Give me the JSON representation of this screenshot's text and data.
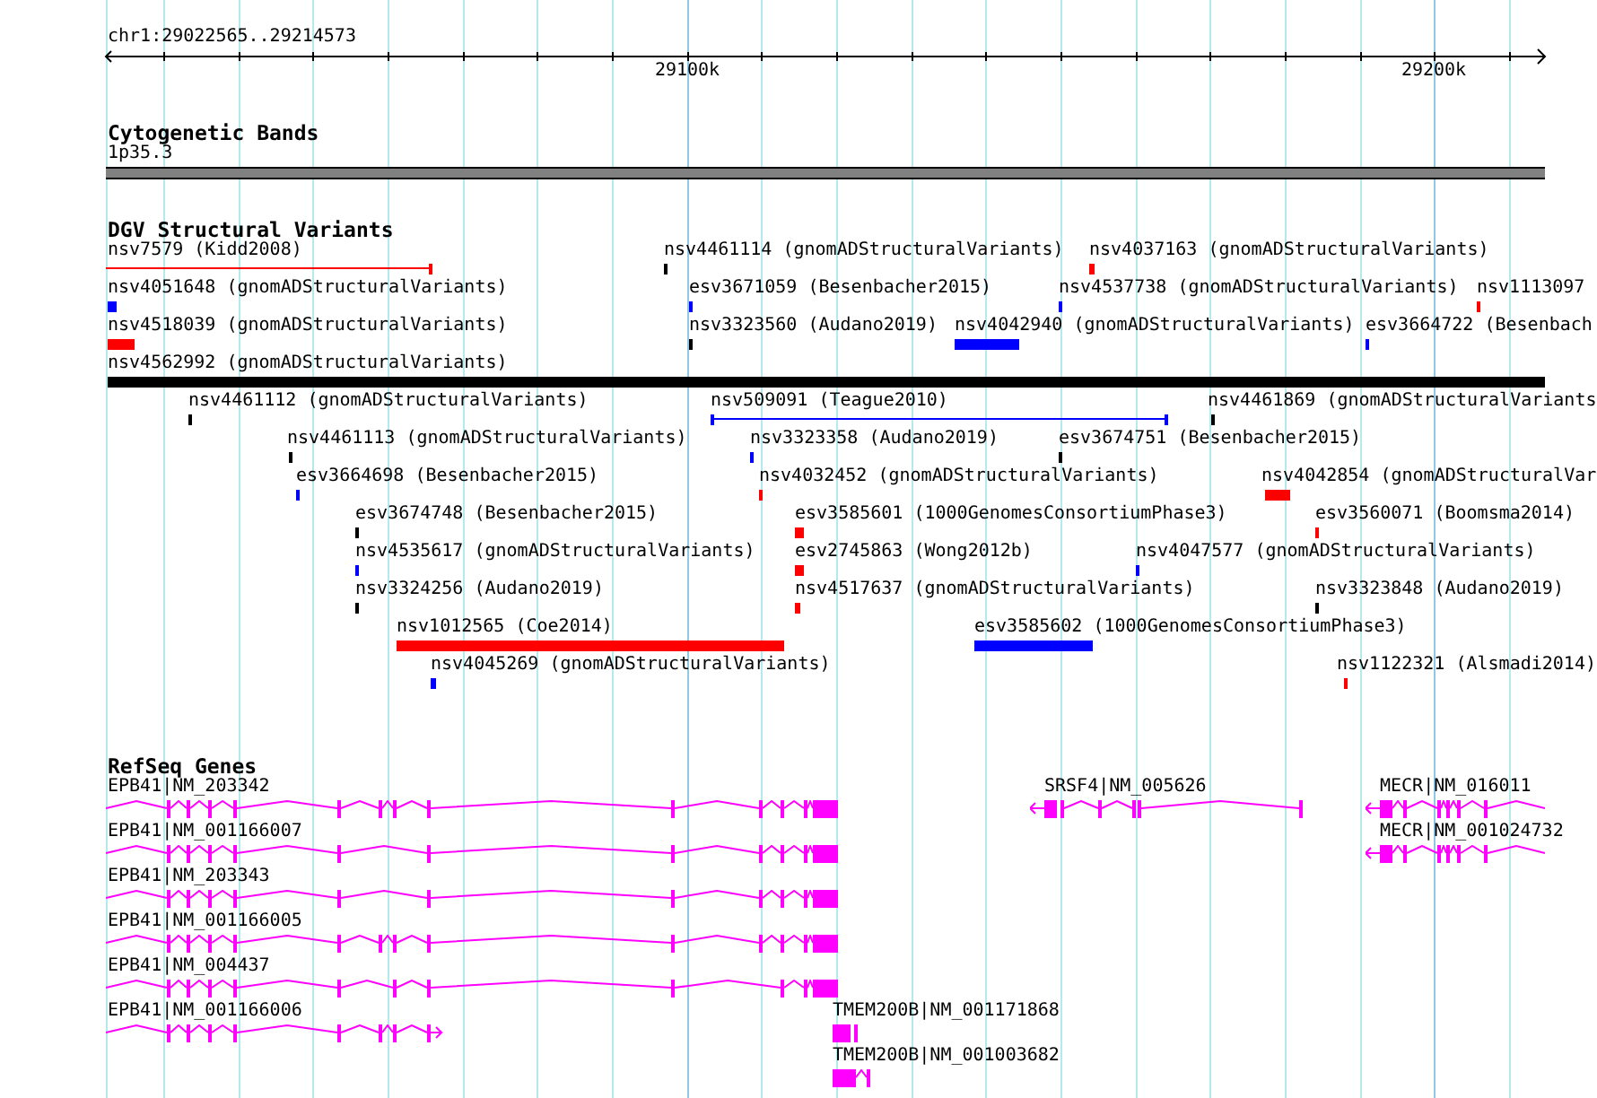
{
  "ruler": {
    "location": "chr1:29022565..29214573",
    "ticks": [
      {
        "label": "29100k"
      },
      {
        "label": "29200k"
      }
    ]
  },
  "tracks": [
    {
      "kind": "bands",
      "title": "Cytogenetic Bands",
      "band": {
        "label": "1p35.3"
      }
    },
    {
      "kind": "variants",
      "title": "DGV Structural Variants",
      "features": [
        {
          "label": "nsv7579 (Kidd2008)",
          "kind": "span",
          "color": "#ff0000"
        },
        {
          "label": "nsv4461114 (gnomADStructuralVariants)",
          "kind": "block",
          "color": "#000000"
        },
        {
          "label": "nsv4037163 (gnomADStructuralVariants)",
          "kind": "block",
          "color": "#ff0000"
        },
        {
          "label": "nsv4051648 (gnomADStructuralVariants)",
          "kind": "block",
          "color": "#0000ff"
        },
        {
          "label": "esv3671059 (Besenbacher2015)",
          "kind": "block",
          "color": "#0000ff"
        },
        {
          "label": "nsv4537738 (gnomADStructuralVariants)",
          "kind": "block",
          "color": "#0000ff"
        },
        {
          "label": "nsv1113097",
          "kind": "block",
          "color": "#ff0000"
        },
        {
          "label": "nsv4518039 (gnomADStructuralVariants)",
          "kind": "block",
          "color": "#ff0000"
        },
        {
          "label": "nsv3323560 (Audano2019)",
          "kind": "block",
          "color": "#000000"
        },
        {
          "label": "nsv4042940 (gnomADStructuralVariants)",
          "kind": "block",
          "color": "#0000ff"
        },
        {
          "label": "esv3664722 (Besenbach",
          "kind": "block",
          "color": "#0000ff"
        },
        {
          "label": "nsv4562992 (gnomADStructuralVariants)",
          "kind": "block",
          "color": "#000000"
        },
        {
          "label": "nsv4461112 (gnomADStructuralVariants)",
          "kind": "block",
          "color": "#000000"
        },
        {
          "label": "nsv509091 (Teague2010)",
          "kind": "span",
          "color": "#0000ff"
        },
        {
          "label": "nsv4461869 (gnomADStructuralVariants",
          "kind": "block",
          "color": "#000000"
        },
        {
          "label": "nsv4461113 (gnomADStructuralVariants)",
          "kind": "block",
          "color": "#000000"
        },
        {
          "label": "nsv3323358 (Audano2019)",
          "kind": "block",
          "color": "#0000ff"
        },
        {
          "label": "esv3674751 (Besenbacher2015)",
          "kind": "block",
          "color": "#000000"
        },
        {
          "label": "esv3664698 (Besenbacher2015)",
          "kind": "block",
          "color": "#0000ff"
        },
        {
          "label": "nsv4032452 (gnomADStructuralVariants)",
          "kind": "block",
          "color": "#ff0000"
        },
        {
          "label": "nsv4042854 (gnomADStructuralVar",
          "kind": "block",
          "color": "#ff0000"
        },
        {
          "label": "esv3674748 (Besenbacher2015)",
          "kind": "block",
          "color": "#000000"
        },
        {
          "label": "esv3585601 (1000GenomesConsortiumPhase3)",
          "kind": "block",
          "color": "#ff0000"
        },
        {
          "label": "esv3560071 (Boomsma2014)",
          "kind": "block",
          "color": "#ff0000"
        },
        {
          "label": "nsv4535617 (gnomADStructuralVariants)",
          "kind": "block",
          "color": "#0000ff"
        },
        {
          "label": "esv2745863 (Wong2012b)",
          "kind": "block",
          "color": "#ff0000"
        },
        {
          "label": "nsv4047577 (gnomADStructuralVariants)",
          "kind": "block",
          "color": "#0000ff"
        },
        {
          "label": "nsv3324256 (Audano2019)",
          "kind": "block",
          "color": "#000000"
        },
        {
          "label": "nsv4517637 (gnomADStructuralVariants)",
          "kind": "block",
          "color": "#ff0000"
        },
        {
          "label": "nsv3323848 (Audano2019)",
          "kind": "block",
          "color": "#000000"
        },
        {
          "label": "nsv1012565 (Coe2014)",
          "kind": "block",
          "color": "#ff0000"
        },
        {
          "label": "esv3585602 (1000GenomesConsortiumPhase3)",
          "kind": "block",
          "color": "#0000ff"
        },
        {
          "label": "nsv4045269 (gnomADStructuralVariants)",
          "kind": "block",
          "color": "#0000ff"
        },
        {
          "label": "nsv1122321 (Alsmadi2014)",
          "kind": "block",
          "color": "#ff0000"
        }
      ]
    },
    {
      "kind": "genes",
      "title": "RefSeq Genes",
      "genes": [
        {
          "label": "EPB41|NM_203342"
        },
        {
          "label": "SRSF4|NM_005626"
        },
        {
          "label": "MECR|NM_016011"
        },
        {
          "label": "EPB41|NM_001166007"
        },
        {
          "label": "MECR|NM_001024732"
        },
        {
          "label": "EPB41|NM_203343"
        },
        {
          "label": "EPB41|NM_001166005"
        },
        {
          "label": "EPB41|NM_004437"
        },
        {
          "label": "EPB41|NM_001166006"
        },
        {
          "label": "TMEM200B|NM_001171868"
        },
        {
          "label": "TMEM200B|NM_001003682"
        }
      ]
    }
  ]
}
